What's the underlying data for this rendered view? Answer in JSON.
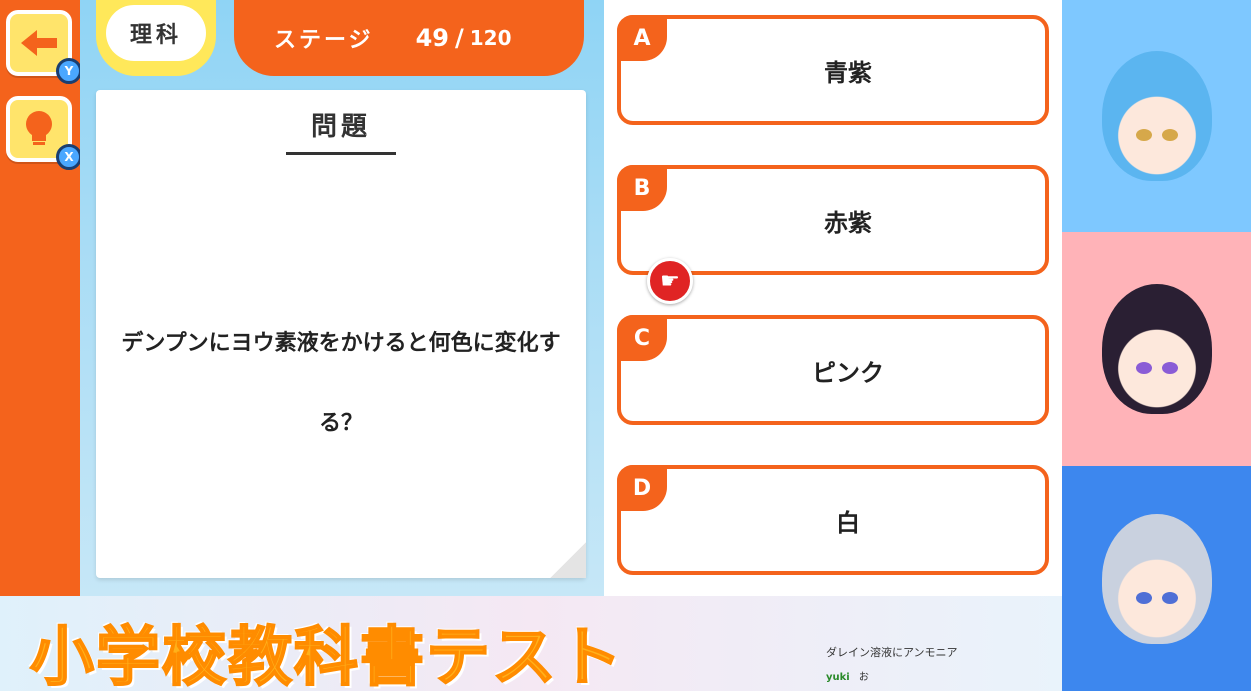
{
  "sidebar": {
    "back_key": "Y",
    "hint_key": "X"
  },
  "header": {
    "subject": "理科",
    "stage_label": "ステージ",
    "stage_current": "49",
    "stage_separator": "/",
    "stage_total": "120"
  },
  "question": {
    "title": "問題",
    "text": "デンプンにヨウ素液をかけると何色に変化する？"
  },
  "answers": [
    {
      "letter": "A",
      "text": "青紫"
    },
    {
      "letter": "B",
      "text": "赤紫"
    },
    {
      "letter": "C",
      "text": "ピンク"
    },
    {
      "letter": "D",
      "text": "白"
    }
  ],
  "banner": {
    "title": "小学校教科書テスト"
  },
  "chat": {
    "line1": "ダレイン溶液にアンモニア",
    "line2_user": "yuki",
    "line2_text": "お"
  },
  "colors": {
    "accent": "#f4631c",
    "yellow": "#ffe85a",
    "banner_text": "#ffb11a"
  },
  "icons": {
    "back": "arrow-left-icon",
    "hint": "lightbulb-icon",
    "cursor": "pointing-hand-icon"
  }
}
